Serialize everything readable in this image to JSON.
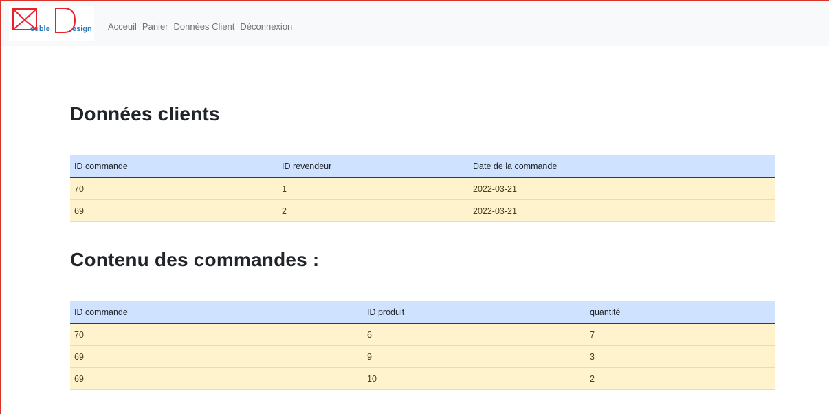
{
  "navbar": {
    "logo": {
      "first_letter_shape": "triangle-m-icon",
      "text_euble": "euble",
      "letter_d": "D",
      "text_esign": "esign",
      "colors": {
        "red": "#e8222b",
        "blue": "#2a7ab8"
      }
    },
    "links": [
      {
        "label": "Acceuil"
      },
      {
        "label": "Panier"
      },
      {
        "label": "Données Client"
      },
      {
        "label": "Déconnexion"
      }
    ]
  },
  "clients": {
    "title": "Données clients",
    "headers": [
      "ID commande",
      "ID revendeur",
      "Date de la commande"
    ],
    "rows": [
      [
        "70",
        "1",
        "2022-03-21"
      ],
      [
        "69",
        "2",
        "2022-03-21"
      ]
    ]
  },
  "orders": {
    "title": "Contenu des commandes :",
    "headers": [
      "ID commande",
      "ID produit",
      "quantité"
    ],
    "rows": [
      [
        "70",
        "6",
        "7"
      ],
      [
        "69",
        "9",
        "3"
      ],
      [
        "69",
        "10",
        "2"
      ]
    ]
  },
  "colors": {
    "header_bg": "#cfe2ff",
    "row_bg": "#fff3cd",
    "frame_border": "#d9342b"
  }
}
